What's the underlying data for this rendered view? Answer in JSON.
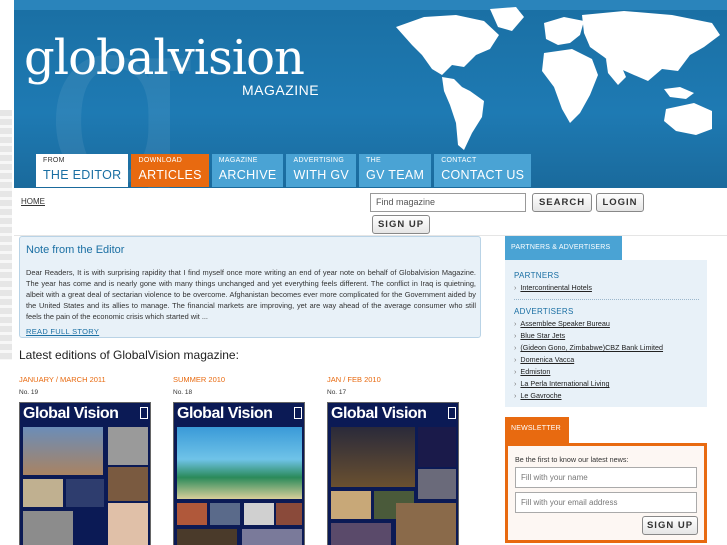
{
  "header": {
    "logo": "globalvision",
    "subtitle": "MAGAZINE"
  },
  "nav": {
    "tabs": [
      {
        "small": "FROM",
        "big": "THE EDITOR"
      },
      {
        "small": "DOWNLOAD",
        "big": "ARTICLES"
      },
      {
        "small": "MAGAZINE",
        "big": "ARCHIVE"
      },
      {
        "small": "ADVERTISING",
        "big": "WITH GV"
      },
      {
        "small": "THE",
        "big": "GV TEAM"
      },
      {
        "small": "CONTACT",
        "big": "CONTACT US"
      }
    ]
  },
  "toolbar": {
    "home": "HOME",
    "search_placeholder": "Find magazine",
    "search_label": "SEARCH",
    "login_label": "LOGIN",
    "signup_label": "SIGN UP"
  },
  "note": {
    "title": "Note from the Editor",
    "body": "Dear Readers, It is with surprising rapidity that I find myself once more writing an end of year note on behalf of Globalvision Magazine. The year has come and is nearly gone with many things unchanged and yet everything feels different. The conflict in Iraq is quietning, albeit with a great deal of sectarian violence to be overcome. Afghanistan becomes ever more complicated for the Government aided by the United States and its allies to manage. The financial markets are improving, yet are way ahead of the average consumer who still feels the pain of the economic crisis which started wit ...",
    "read_more": "READ FULL STORY"
  },
  "latest": {
    "heading": "Latest editions of GlobalVision magazine:",
    "issues": [
      {
        "date": "JANUARY / MARCH 2011",
        "number": "No. 19",
        "cover_title": "Global Vision"
      },
      {
        "date": "SUMMER 2010",
        "number": "No. 18",
        "cover_title": "Global Vision"
      },
      {
        "date": "JAN / FEB 2010",
        "number": "No. 17",
        "cover_title": "Global Vision"
      }
    ]
  },
  "partners": {
    "tab": "PARTNERS & ADVERTISERS",
    "partners_heading": "PARTNERS",
    "partners": [
      "Intercontinental Hotels"
    ],
    "advertisers_heading": "ADVERTISERS",
    "advertisers": [
      "Assemblee Speaker Bureau",
      "Blue Star Jets",
      "(Gideon Gono, Zimbabwe)CBZ Bank Limited",
      "Domenica Vacca",
      "Edmiston",
      "La Perla International Living",
      "Le Gavroche"
    ]
  },
  "newsletter": {
    "tab": "NEWSLETTER",
    "label": "Be the first to know our latest news:",
    "name_placeholder": "Fill with your name",
    "email_placeholder": "Fill with your email address",
    "signup_label": "SIGN UP"
  }
}
